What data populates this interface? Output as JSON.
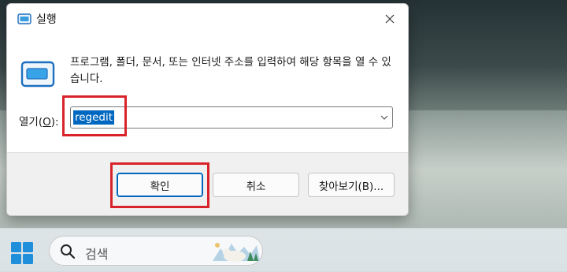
{
  "dialog": {
    "title": "실행",
    "description": "프로그램, 폴더, 문서, 또는 인터넷 주소를 입력하여 해당 항목을 열 수 있습니다.",
    "open_label_pre": "열기(",
    "open_label_key": "O",
    "open_label_post": "):",
    "open_value": "regedit",
    "buttons": {
      "ok": "확인",
      "cancel": "취소",
      "browse": "찾아보기(B)..."
    }
  },
  "taskbar": {
    "search_placeholder": "검색"
  },
  "colors": {
    "accent": "#0067c0",
    "highlight_box": "#d8232a"
  },
  "icons": [
    "run-app-icon",
    "close-icon",
    "chevron-down-icon",
    "windows-start-icon",
    "search-icon"
  ]
}
